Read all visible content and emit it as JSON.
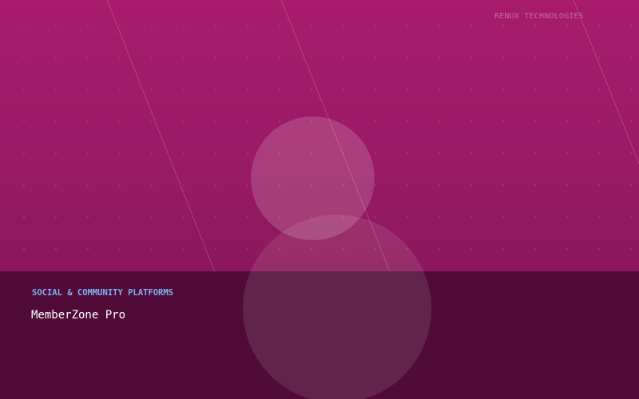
{
  "brand": {
    "name": "RENUX TECHNOLOGIES"
  },
  "hero": {
    "category": "SOCIAL & COMMUNITY PLATFORMS",
    "title": "MemberZone Pro"
  },
  "colors": {
    "background_top": "#a71c6b",
    "background_bottom": "#8a165a",
    "caption_band": "#510b38",
    "category_text": "#7fb2ee",
    "title_text": "#ffffff"
  }
}
